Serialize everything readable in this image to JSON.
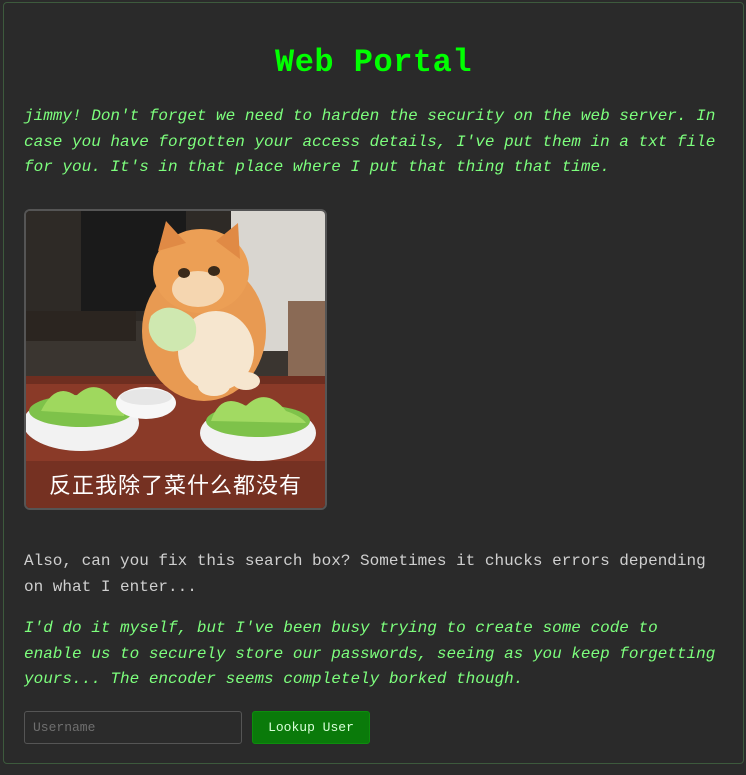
{
  "page": {
    "title": "Web Portal"
  },
  "messages": {
    "intro": "jimmy! Don't forget we need to harden the security on the web server. In case you have forgotten your access details, I've put them in a txt file for you. It's in that place where I put that thing that time.",
    "search_note": "Also, can you fix this search box? Sometimes it chucks errors depending on what I enter...",
    "encoder_note": "I'd do it myself, but I've been busy trying to create some code to enable us to securely store our passwords, seeing as you keep forgetting yours... The encoder seems completely borked though."
  },
  "meme": {
    "caption": "反正我除了菜什么都没有"
  },
  "search": {
    "placeholder": "Username",
    "value": "",
    "button_label": "Lookup User"
  },
  "colors": {
    "accent": "#00ff00",
    "italic_text": "#7dff7d",
    "button_bg": "#0a7a0a",
    "background": "#2a2a2a"
  }
}
